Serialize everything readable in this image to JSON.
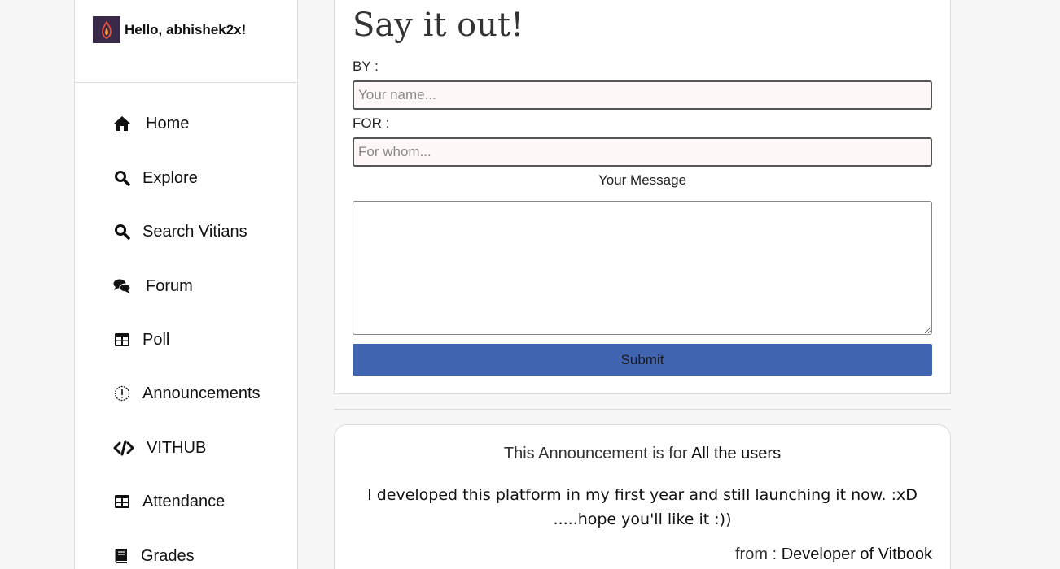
{
  "user": {
    "greeting": "Hello, abhishek2x!"
  },
  "nav": {
    "items": [
      {
        "label": "Home",
        "icon": "home-icon"
      },
      {
        "label": "Explore",
        "icon": "search-icon"
      },
      {
        "label": "Search Vitians",
        "icon": "search-icon"
      },
      {
        "label": "Forum",
        "icon": "comments-icon"
      },
      {
        "label": "Poll",
        "icon": "table-icon"
      },
      {
        "label": "Announcements",
        "icon": "exclamation-circle-icon"
      },
      {
        "label": "VITHUB",
        "icon": "code-icon"
      },
      {
        "label": "Attendance",
        "icon": "table-icon"
      },
      {
        "label": "Grades",
        "icon": "book-icon"
      }
    ]
  },
  "form": {
    "title": "Say it out!",
    "by_label": "BY :",
    "by_placeholder": "Your name...",
    "for_label": "FOR :",
    "for_placeholder": "For whom...",
    "message_label": "Your Message",
    "submit_label": "Submit"
  },
  "announcement": {
    "for_prefix": "This Announcement is for",
    "for_value": "All the users",
    "message": "I developed this platform in my first year and still launching it now. :xD .....hope you'll like it :))",
    "from_prefix": "from :",
    "from_value": "Developer of Vitbook"
  },
  "colors": {
    "primary": "#4164b0",
    "input_bg": "#fdf7f7"
  }
}
